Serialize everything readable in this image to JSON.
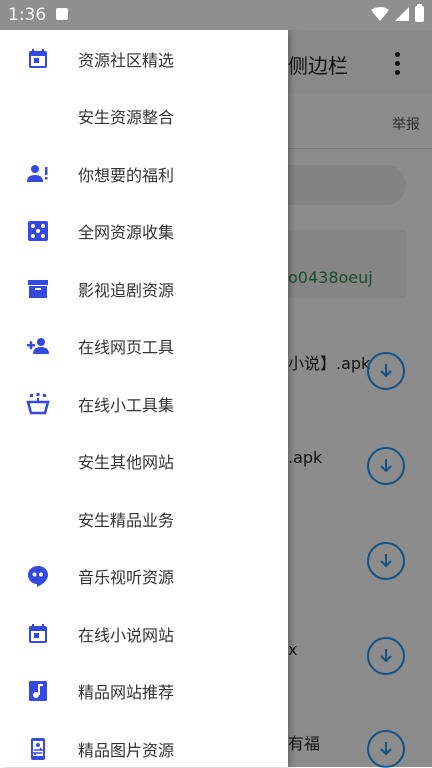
{
  "status_bar": {
    "time": "1:36"
  },
  "background_app": {
    "title": "侧边栏",
    "report": "举报",
    "code_text": "o0438oeuj",
    "list": [
      {
        "text": "小说】.apk"
      },
      {
        "text": ".apk"
      },
      {
        "text": ""
      },
      {
        "text": "x"
      },
      {
        "text": "有福"
      }
    ]
  },
  "accent_color": "#3548e0",
  "drawer": {
    "items": [
      {
        "label": "资源社区精选",
        "icon": "calendar-icon"
      },
      {
        "label": "安生资源整合",
        "icon": ""
      },
      {
        "label": "你想要的福利",
        "icon": "person-alert-icon"
      },
      {
        "label": "全网资源收集",
        "icon": "dice-icon"
      },
      {
        "label": "影视追剧资源",
        "icon": "archive-icon"
      },
      {
        "label": "在线网页工具",
        "icon": "person-add-icon"
      },
      {
        "label": "在线小工具集",
        "icon": "basket-icon"
      },
      {
        "label": "安生其他网站",
        "icon": ""
      },
      {
        "label": "安生精品业务",
        "icon": ""
      },
      {
        "label": "音乐视听资源",
        "icon": "quote-bubble-icon"
      },
      {
        "label": "在线小说网站",
        "icon": "calendar-icon"
      },
      {
        "label": "精品网站推荐",
        "icon": "music-note-icon"
      },
      {
        "label": "精品图片资源",
        "icon": "phone-swap-icon"
      }
    ]
  }
}
